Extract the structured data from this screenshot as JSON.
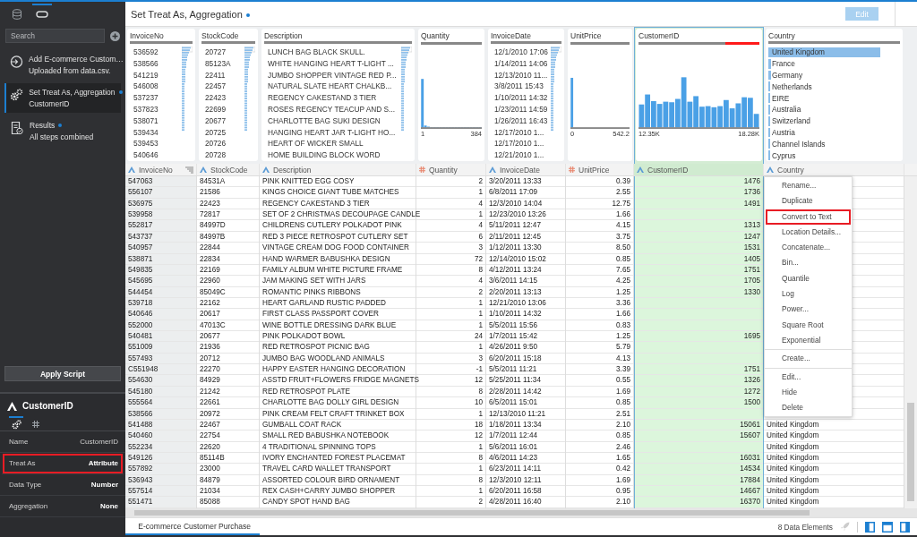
{
  "sidebar": {
    "tabs": [
      {
        "kind": "database",
        "selected": false
      },
      {
        "kind": "script",
        "selected": true
      }
    ],
    "search": {
      "placeholder": "Search"
    },
    "steps": [
      {
        "kind": "add",
        "title": "Add E-commerce Custom…",
        "subtitle": "Uploaded from data.csv.",
        "selected": false,
        "modified": false
      },
      {
        "kind": "transform",
        "title": "Set Treat As, Aggregation",
        "subtitle": "CustomerID",
        "selected": true,
        "modified": true
      },
      {
        "kind": "results",
        "title": "Results",
        "subtitle": "All steps combined",
        "selected": false,
        "modified": true
      }
    ],
    "apply_button": "Apply Script",
    "properties": {
      "title": "CustomerID",
      "tabs": [
        {
          "kind": "general",
          "selected": true
        },
        {
          "kind": "measure",
          "selected": false
        }
      ],
      "rows": [
        {
          "label": "Name",
          "value": "CustomerID",
          "highlighted": false,
          "bold": false
        },
        {
          "label": "Treat As",
          "value": "Attribute",
          "highlighted": true,
          "bold": true
        },
        {
          "label": "Data Type",
          "value": "Number",
          "highlighted": false,
          "bold": true
        },
        {
          "label": "Aggregation",
          "value": "None",
          "highlighted": false,
          "bold": true
        }
      ]
    }
  },
  "header": {
    "title": "Set Treat As, Aggregation",
    "modified": true,
    "edit_button": {
      "label": "Edit",
      "disabled": true
    }
  },
  "columns": [
    {
      "name": "InvoiceNo",
      "heading": "InvoiceNo",
      "kind": "attribute",
      "selected": false,
      "quality": {
        "level": 1
      },
      "summary": {
        "kind": "list",
        "values": [
          "536592",
          "538566",
          "541219",
          "546008",
          "537237",
          "537823",
          "538071",
          "539434",
          "539453",
          "540646"
        ]
      }
    },
    {
      "name": "StockCode",
      "heading": "StockCode",
      "kind": "attribute",
      "selected": false,
      "quality": {
        "level": 1
      },
      "summary": {
        "kind": "list",
        "values": [
          "20727",
          "85123A",
          "22411",
          "22457",
          "22423",
          "22699",
          "20677",
          "20725",
          "20726",
          "20728"
        ]
      }
    },
    {
      "name": "Description",
      "heading": "Description",
      "kind": "attribute",
      "selected": false,
      "quality": {
        "level": 1
      },
      "summary": {
        "kind": "list",
        "values": [
          "LUNCH BAG BLACK SKULL.",
          "WHITE HANGING HEART T-LIGHT ...",
          "JUMBO SHOPPER VINTAGE RED P...",
          "NATURAL SLATE HEART CHALKB...",
          "REGENCY CAKESTAND 3 TIER",
          "ROSES REGENCY TEACUP AND S...",
          "CHARLOTTE BAG SUKI DESIGN",
          "HANGING HEART JAR T-LIGHT HO...",
          "HEART OF WICKER SMALL",
          "HOME BUILDING BLOCK WORD"
        ]
      }
    },
    {
      "name": "Quantity",
      "heading": "Quantity",
      "kind": "measure",
      "selected": false,
      "quality": {
        "level": 1
      },
      "summary": {
        "kind": "histogram",
        "min": "1",
        "max": "384"
      }
    },
    {
      "name": "InvoiceDate",
      "heading": "InvoiceDate",
      "kind": "attribute",
      "selected": false,
      "quality": {
        "level": 1
      },
      "summary": {
        "kind": "list",
        "values": [
          "12/1/2010 17:06",
          "1/14/2011 14:06",
          "12/13/2010 11...",
          "3/8/2011 15:43",
          "1/10/2011 14:32",
          "1/23/2011 14:59",
          "1/26/2011 16:43",
          "12/17/2010 1...",
          "12/17/2010 1...",
          "12/21/2010 1..."
        ]
      }
    },
    {
      "name": "UnitPrice",
      "heading": "UnitPrice",
      "kind": "measure",
      "selected": false,
      "quality": {
        "level": 1
      },
      "summary": {
        "kind": "histogram",
        "min": "0",
        "max": "542.2"
      }
    },
    {
      "name": "CustomerID",
      "heading": "CustomerID",
      "kind": "attribute",
      "selected": true,
      "quality": {
        "level": 0.72
      },
      "summary": {
        "kind": "histogram",
        "min": "12.35K",
        "max": "18.28K"
      }
    },
    {
      "name": "Country",
      "heading": "Country",
      "kind": "attribute",
      "selected": false,
      "quality": {
        "level": 1
      },
      "summary": {
        "kind": "bars",
        "items": [
          {
            "label": "United Kingdom",
            "level": 0.85
          },
          {
            "label": "France",
            "level": 0.02
          },
          {
            "label": "Germany",
            "level": 0.02
          },
          {
            "label": "Netherlands",
            "level": 0.015
          },
          {
            "label": "EIRE",
            "level": 0.015
          },
          {
            "label": "Australia",
            "level": 0.01
          },
          {
            "label": "Switzerland",
            "level": 0.01
          },
          {
            "label": "Austria",
            "level": 0.005
          },
          {
            "label": "Channel Islands",
            "level": 0.005
          },
          {
            "label": "Cyprus",
            "level": 0.005
          }
        ]
      }
    }
  ],
  "rows": [
    {
      "invoice_no": "547063",
      "stock_code": "84531A",
      "description": "PINK KNITTED EGG COSY",
      "quantity": "2",
      "invoice_date": "3/20/2011 13:33",
      "unit_price": "0.39",
      "customer_id": "1476"
    },
    {
      "invoice_no": "556107",
      "stock_code": "21586",
      "description": "KINGS CHOICE GIANT TUBE MATCHES",
      "quantity": "1",
      "invoice_date": "6/8/2011 17:09",
      "unit_price": "2.55",
      "customer_id": "1736"
    },
    {
      "invoice_no": "536975",
      "stock_code": "22423",
      "description": "REGENCY CAKESTAND 3 TIER",
      "quantity": "4",
      "invoice_date": "12/3/2010 14:04",
      "unit_price": "12.75",
      "customer_id": "1491"
    },
    {
      "invoice_no": "539958",
      "stock_code": "72817",
      "description": "SET OF 2 CHRISTMAS DECOUPAGE CANDLE",
      "quantity": "1",
      "invoice_date": "12/23/2010 13:26",
      "unit_price": "1.66"
    },
    {
      "invoice_no": "552817",
      "stock_code": "84997D",
      "description": "CHILDRENS CUTLERY POLKADOT PINK",
      "quantity": "4",
      "invoice_date": "5/11/2011 12:47",
      "unit_price": "4.15",
      "customer_id": "1313"
    },
    {
      "invoice_no": "543737",
      "stock_code": "84997B",
      "description": "RED 3 PIECE RETROSPOT CUTLERY SET",
      "quantity": "6",
      "invoice_date": "2/11/2011 12:45",
      "unit_price": "3.75",
      "customer_id": "1247"
    },
    {
      "invoice_no": "540957",
      "stock_code": "22844",
      "description": "VINTAGE CREAM DOG FOOD CONTAINER",
      "quantity": "3",
      "invoice_date": "1/12/2011 13:30",
      "unit_price": "8.50",
      "customer_id": "1531"
    },
    {
      "invoice_no": "538871",
      "stock_code": "22834",
      "description": "HAND WARMER BABUSHKA DESIGN",
      "quantity": "72",
      "invoice_date": "12/14/2010 15:02",
      "unit_price": "0.85",
      "customer_id": "1405"
    },
    {
      "invoice_no": "549835",
      "stock_code": "22169",
      "description": "FAMILY ALBUM WHITE PICTURE FRAME",
      "quantity": "8",
      "invoice_date": "4/12/2011 13:24",
      "unit_price": "7.65",
      "customer_id": "1751"
    },
    {
      "invoice_no": "545695",
      "stock_code": "22960",
      "description": "JAM MAKING SET WITH JARS",
      "quantity": "4",
      "invoice_date": "3/6/2011 14:15",
      "unit_price": "4.25",
      "customer_id": "1705"
    },
    {
      "invoice_no": "544454",
      "stock_code": "85049C",
      "description": "ROMANTIC PINKS RIBBONS",
      "quantity": "2",
      "invoice_date": "2/20/2011 13:13",
      "unit_price": "1.25",
      "customer_id": "1330"
    },
    {
      "invoice_no": "539718",
      "stock_code": "22162",
      "description": "HEART GARLAND RUSTIC PADDED",
      "quantity": "1",
      "invoice_date": "12/21/2010 13:06",
      "unit_price": "3.36"
    },
    {
      "invoice_no": "540646",
      "stock_code": "20617",
      "description": "FIRST CLASS PASSPORT COVER",
      "quantity": "1",
      "invoice_date": "1/10/2011 14:32",
      "unit_price": "1.66"
    },
    {
      "invoice_no": "552000",
      "stock_code": "47013C",
      "description": "WINE BOTTLE DRESSING DARK BLUE",
      "quantity": "1",
      "invoice_date": "5/5/2011 15:56",
      "unit_price": "0.83"
    },
    {
      "invoice_no": "540481",
      "stock_code": "20677",
      "description": "PINK POLKADOT BOWL",
      "quantity": "24",
      "invoice_date": "1/7/2011 15:42",
      "unit_price": "1.25",
      "customer_id": "1695"
    },
    {
      "invoice_no": "551009",
      "stock_code": "21936",
      "description": "RED RETROSPOT PICNIC BAG",
      "quantity": "1",
      "invoice_date": "4/26/2011 9:50",
      "unit_price": "5.79"
    },
    {
      "invoice_no": "557493",
      "stock_code": "20712",
      "description": "JUMBO BAG WOODLAND ANIMALS",
      "quantity": "3",
      "invoice_date": "6/20/2011 15:18",
      "unit_price": "4.13"
    },
    {
      "invoice_no": "C551948",
      "stock_code": "22270",
      "description": "HAPPY EASTER HANGING DECORATION",
      "quantity": "-1",
      "invoice_date": "5/5/2011 11:21",
      "unit_price": "3.39",
      "customer_id": "1751"
    },
    {
      "invoice_no": "554630",
      "stock_code": "84929",
      "description": "ASSTD FRUIT+FLOWERS FRIDGE MAGNETS",
      "quantity": "12",
      "invoice_date": "5/25/2011 11:34",
      "unit_price": "0.55",
      "customer_id": "1326"
    },
    {
      "invoice_no": "545180",
      "stock_code": "21242",
      "description": "RED RETROSPOT PLATE",
      "quantity": "8",
      "invoice_date": "2/28/2011 14:42",
      "unit_price": "1.69",
      "customer_id": "1272"
    },
    {
      "invoice_no": "555564",
      "stock_code": "22661",
      "description": "CHARLOTTE BAG DOLLY GIRL DESIGN",
      "quantity": "10",
      "invoice_date": "6/5/2011 15:01",
      "unit_price": "0.85",
      "customer_id": "1500"
    },
    {
      "invoice_no": "538566",
      "stock_code": "20972",
      "description": "PINK CREAM FELT CRAFT TRINKET BOX",
      "quantity": "1",
      "invoice_date": "12/13/2010 11:21",
      "unit_price": "2.51"
    },
    {
      "invoice_no": "541488",
      "stock_code": "22467",
      "description": "GUMBALL COAT RACK",
      "quantity": "18",
      "invoice_date": "1/18/2011 13:34",
      "unit_price": "2.10",
      "customer_id": "15061",
      "country": "United Kingdom"
    },
    {
      "invoice_no": "540460",
      "stock_code": "22754",
      "description": "SMALL RED BABUSHKA NOTEBOOK",
      "quantity": "12",
      "invoice_date": "1/7/2011 12:44",
      "unit_price": "0.85",
      "customer_id": "15607",
      "country": "United Kingdom"
    },
    {
      "invoice_no": "552234",
      "stock_code": "22620",
      "description": "4 TRADITIONAL SPINNING TOPS",
      "quantity": "1",
      "invoice_date": "5/6/2011 16:01",
      "unit_price": "2.46",
      "country": "United Kingdom"
    },
    {
      "invoice_no": "549126",
      "stock_code": "85114B",
      "description": "IVORY ENCHANTED FOREST PLACEMAT",
      "quantity": "8",
      "invoice_date": "4/6/2011 14:23",
      "unit_price": "1.65",
      "customer_id": "16031",
      "country": "United Kingdom"
    },
    {
      "invoice_no": "557892",
      "stock_code": "23000",
      "description": "TRAVEL CARD WALLET TRANSPORT",
      "quantity": "1",
      "invoice_date": "6/23/2011 14:11",
      "unit_price": "0.42",
      "customer_id": "14534",
      "country": "United Kingdom"
    },
    {
      "invoice_no": "536943",
      "stock_code": "84879",
      "description": "ASSORTED COLOUR BIRD ORNAMENT",
      "quantity": "8",
      "invoice_date": "12/3/2010 12:11",
      "unit_price": "1.69",
      "customer_id": "17884",
      "country": "United Kingdom"
    },
    {
      "invoice_no": "557514",
      "stock_code": "21034",
      "description": "REX CASH+CARRY JUMBO SHOPPER",
      "quantity": "1",
      "invoice_date": "6/20/2011 16:58",
      "unit_price": "0.95",
      "customer_id": "14667",
      "country": "United Kingdom"
    },
    {
      "invoice_no": "551471",
      "stock_code": "85088",
      "description": "CANDY SPOT HAND BAG",
      "quantity": "2",
      "invoice_date": "4/28/2011 16:40",
      "unit_price": "2.10",
      "customer_id": "16370",
      "country": "United Kingdom"
    }
  ],
  "context_menu": {
    "items": [
      {
        "kind": "item",
        "label": "Rename...",
        "highlighted": false
      },
      {
        "kind": "item",
        "label": "Duplicate",
        "highlighted": false
      },
      {
        "kind": "item",
        "label": "Convert to Text",
        "highlighted": true
      },
      {
        "kind": "item",
        "label": "Location Details...",
        "highlighted": false
      },
      {
        "kind": "item",
        "label": "Concatenate...",
        "highlighted": false
      },
      {
        "kind": "item",
        "label": "Bin...",
        "highlighted": false
      },
      {
        "kind": "item",
        "label": "Quantile",
        "highlighted": false
      },
      {
        "kind": "item",
        "label": "Log",
        "highlighted": false
      },
      {
        "kind": "item",
        "label": "Power...",
        "highlighted": false
      },
      {
        "kind": "item",
        "label": "Square Root",
        "highlighted": false
      },
      {
        "kind": "item",
        "label": "Exponential",
        "highlighted": false
      },
      {
        "kind": "separator"
      },
      {
        "kind": "item",
        "label": "Create...",
        "highlighted": false
      },
      {
        "kind": "separator"
      },
      {
        "kind": "item",
        "label": "Edit...",
        "highlighted": false
      },
      {
        "kind": "item",
        "label": "Hide",
        "highlighted": false
      },
      {
        "kind": "item",
        "label": "Delete",
        "highlighted": false
      }
    ]
  },
  "footer": {
    "tabs": [
      {
        "label": "E-commerce Customer Purchase",
        "selected": true
      }
    ],
    "element_count": "8 Data Elements"
  }
}
